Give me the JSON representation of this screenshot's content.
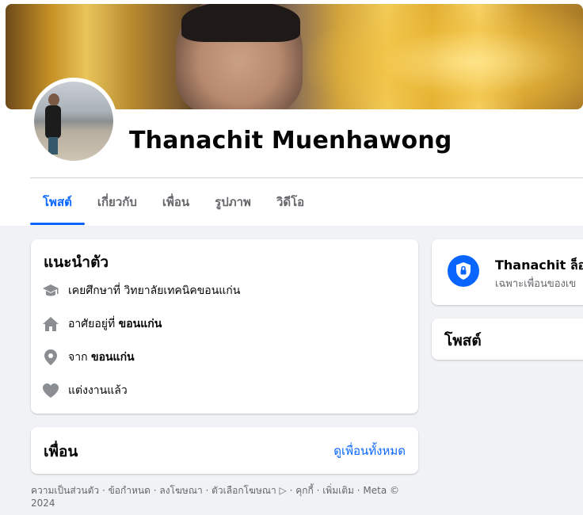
{
  "profile": {
    "name": "Thanachit Muenhawong"
  },
  "tabs": [
    {
      "label": "โพสต์",
      "active": true
    },
    {
      "label": "เกี่ยวกับ",
      "active": false
    },
    {
      "label": "เพื่อน",
      "active": false
    },
    {
      "label": "รูปภาพ",
      "active": false
    },
    {
      "label": "วิดีโอ",
      "active": false
    }
  ],
  "intro": {
    "title": "แนะนำตัว",
    "items": [
      {
        "icon": "graduation-cap-icon",
        "prefix": "เคยศึกษาที่ วิทยาลัยเทคนิคขอนแก่น",
        "bold": ""
      },
      {
        "icon": "home-icon",
        "prefix": "อาศัยอยู่ที่ ",
        "bold": "ขอนแก่น"
      },
      {
        "icon": "location-pin-icon",
        "prefix": "จาก ",
        "bold": "ขอนแก่น"
      },
      {
        "icon": "heart-icon",
        "prefix": "แต่งงานแล้ว",
        "bold": ""
      }
    ]
  },
  "friends": {
    "title": "เพื่อน",
    "see_all": "ดูเพื่อนทั้งหมด"
  },
  "footer": {
    "text": "ความเป็นส่วนตัว · ข้อกำหนด · ลงโฆษณา · ตัวเลือกโฆษณา ▷ · คุกกี้ · เพิ่มเติม · Meta © 2024"
  },
  "locked_profile": {
    "title": "Thanachit ล็อก",
    "subtitle": "เฉพาะเพื่อนของเข"
  },
  "posts": {
    "title": "โพสต์"
  },
  "colors": {
    "accent": "#0866ff",
    "background": "#f0f2f5",
    "secondary_text": "#65676b"
  }
}
